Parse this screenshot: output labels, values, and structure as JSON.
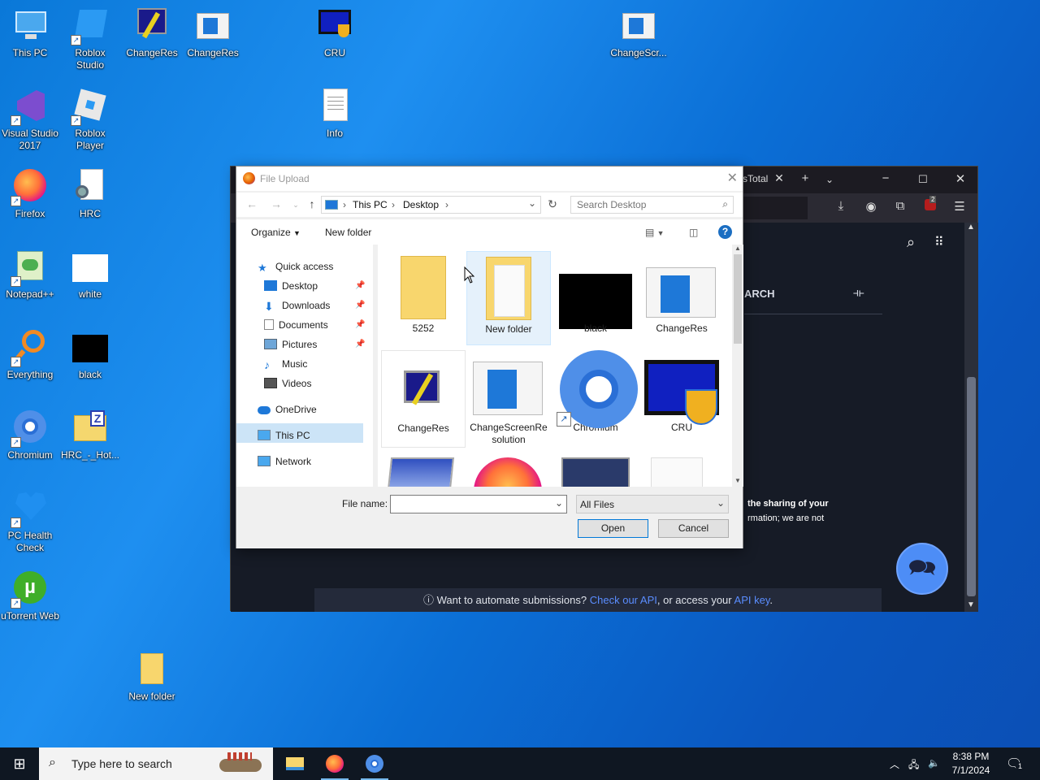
{
  "desktop": {
    "icons": [
      {
        "label": "This PC"
      },
      {
        "label": "Roblox Studio"
      },
      {
        "label": "ChangeRes"
      },
      {
        "label": "ChangeRes"
      },
      {
        "label": "CRU"
      },
      {
        "label": "ChangeScr..."
      },
      {
        "label": "Visual Studio 2017"
      },
      {
        "label": "Roblox Player"
      },
      {
        "label": "Info"
      },
      {
        "label": "Firefox"
      },
      {
        "label": "HRC"
      },
      {
        "label": "Notepad++"
      },
      {
        "label": "white"
      },
      {
        "label": "Everything"
      },
      {
        "label": "black"
      },
      {
        "label": "Chromium"
      },
      {
        "label": "HRC_-_Hot..."
      },
      {
        "label": "PC Health Check"
      },
      {
        "label": "uTorrent Web"
      },
      {
        "label": "New folder"
      }
    ]
  },
  "browser": {
    "tab_fragment": "sTotal",
    "content_fragment": "ARCH",
    "text_line1": "the sharing of your",
    "text_line2": "rmation; we are not",
    "banner": {
      "icon": "ⓘ",
      "prefix": "Want to automate submissions?",
      "link1": "Check our API",
      "middle": ", or access your",
      "link2": "API key",
      "suffix": "."
    },
    "downloads_badge": "2"
  },
  "dialog": {
    "title": "File Upload",
    "breadcrumb": [
      "This PC",
      "Desktop"
    ],
    "search_placeholder": "Search Desktop",
    "organize_label": "Organize",
    "new_folder_label": "New folder",
    "nav": {
      "quick_access": "Quick access",
      "desktop": "Desktop",
      "downloads": "Downloads",
      "documents": "Documents",
      "pictures": "Pictures",
      "music": "Music",
      "videos": "Videos",
      "onedrive": "OneDrive",
      "this_pc": "This PC",
      "network": "Network"
    },
    "files": [
      {
        "name": "5252"
      },
      {
        "name": "New folder"
      },
      {
        "name": "black"
      },
      {
        "name": "ChangeRes"
      },
      {
        "name": "ChangeRes"
      },
      {
        "name": "ChangeScreenRe solution"
      },
      {
        "name": "Chromium"
      },
      {
        "name": "CRU"
      }
    ],
    "file_name_label": "File name:",
    "file_name_value": "",
    "file_type": "All Files",
    "open_label": "Open",
    "cancel_label": "Cancel"
  },
  "taskbar": {
    "search_placeholder": "Type here to search",
    "time": "8:38 PM",
    "date": "7/1/2024",
    "notification_count": "1"
  },
  "colors": {
    "desktop_blue": "#0a78d8",
    "accent": "#0078d7",
    "browser_dark": "#161b26",
    "link": "#5a8dff"
  }
}
